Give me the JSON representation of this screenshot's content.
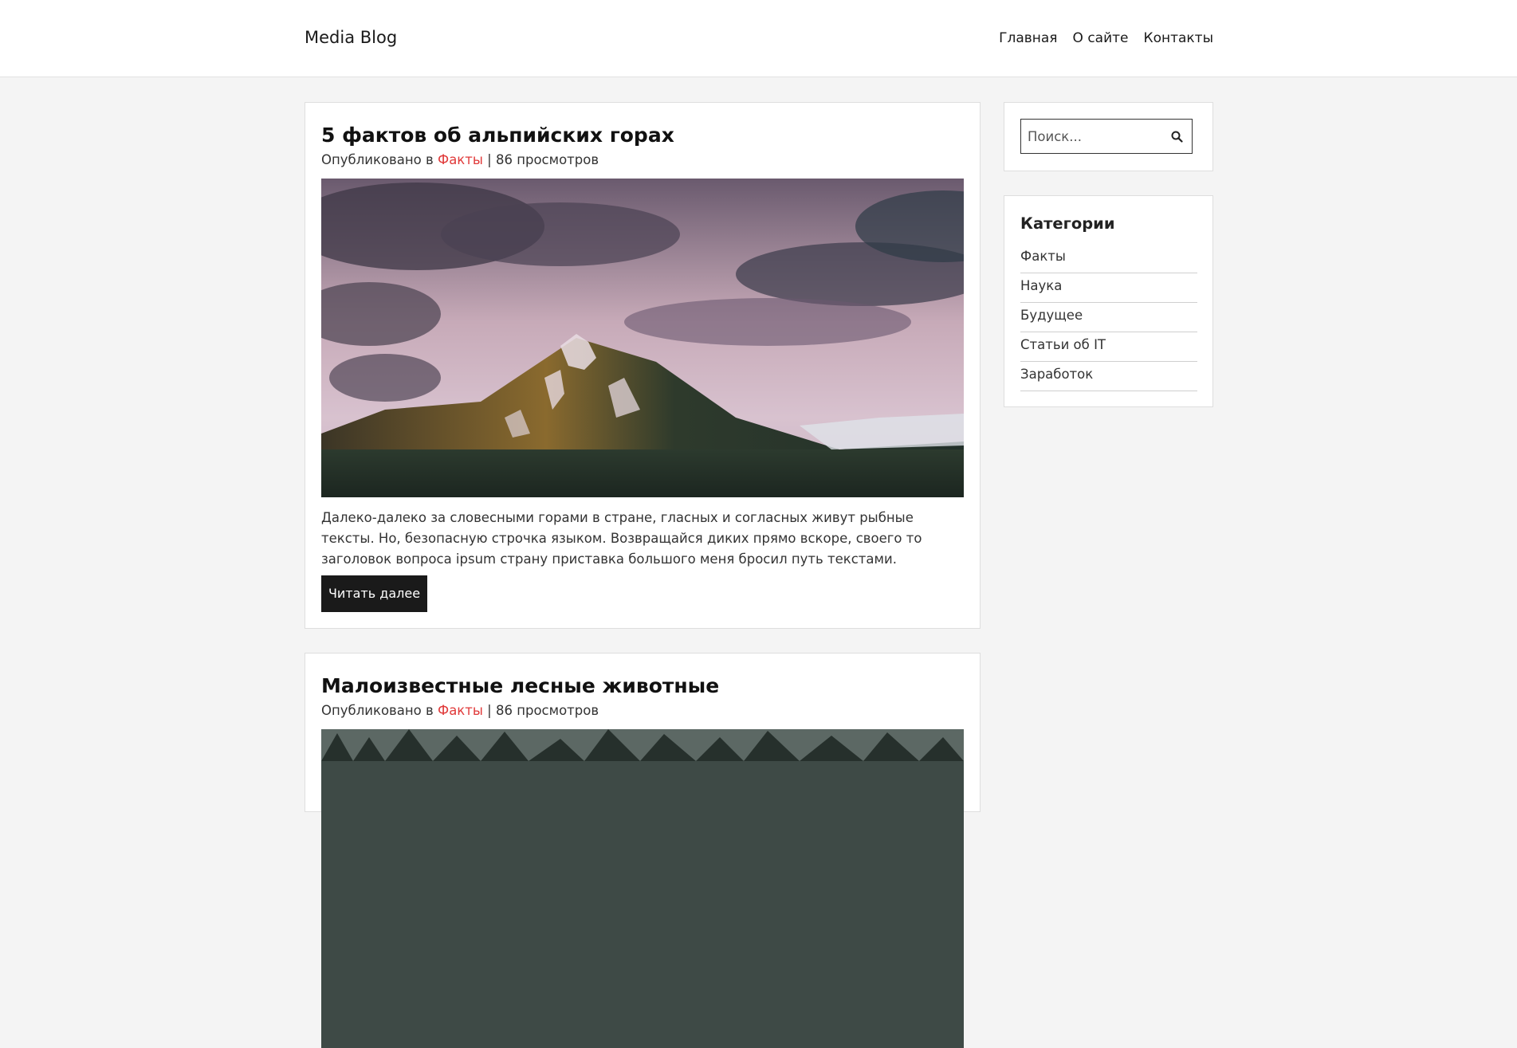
{
  "header": {
    "brand": "Media Blog",
    "nav": [
      "Главная",
      "О сайте",
      "Контакты"
    ]
  },
  "posts": [
    {
      "title": "5 фактов об альпийских горах",
      "meta_prefix": "Опубликовано в ",
      "category": "Факты",
      "views": " | 86 просмотров",
      "excerpt": "Далеко-далеко за словесными горами в стране, гласных и согласных живут рыбные тексты. Но, безопасную строчка языком. Возвращайся диких прямо вскоре, своего то заголовок вопроса ipsum страну приставка большого меня бросил путь текстами.",
      "read_more": "Читать далее"
    },
    {
      "title": "Малоизвестные лесные животные",
      "meta_prefix": "Опубликовано в ",
      "category": "Факты",
      "views": " | 86 просмотров"
    }
  ],
  "sidebar": {
    "search_placeholder": "Поиск...",
    "categories_title": "Категории",
    "categories": [
      "Факты",
      "Наука",
      "Будущее",
      "Статьи об IT",
      "Заработок"
    ]
  },
  "colors": {
    "accent": "#e03a3a",
    "button": "#1a1a1a"
  }
}
